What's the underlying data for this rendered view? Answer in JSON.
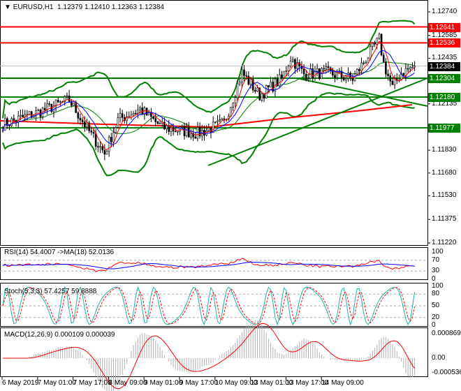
{
  "header": {
    "symbol": "EURUSD,H1",
    "ohlc": "1.12379 1.12410 1.12363 1.12384"
  },
  "colors": {
    "bull": "#ffffff",
    "bear": "#000000",
    "band": "#008000",
    "ma_fast": "#ff0000",
    "ma_slow": "#0000ff",
    "level_red": "#ff0000",
    "level_green": "#008000",
    "current": "#000000"
  },
  "chart_data": {
    "type": "line",
    "title": "EURUSD,H1",
    "ylim": [
      1.1122,
      1.1274
    ],
    "price_ticks": [
      "1.12740",
      "1.12585",
      "1.12435",
      "1.12285",
      "1.12135",
      "1.11830",
      "1.11680",
      "1.11530",
      "1.11375",
      "1.11220"
    ],
    "price_path_hours": [
      0,
      8,
      16,
      30,
      40,
      46,
      52,
      62,
      72,
      88,
      100,
      108,
      116,
      126,
      130,
      136,
      146,
      158,
      170,
      172,
      176,
      180,
      186
    ],
    "price_path_values": [
      1.12,
      1.1204,
      1.1208,
      1.1216,
      1.1193,
      1.1181,
      1.1203,
      1.121,
      1.1198,
      1.1194,
      1.1201,
      1.1234,
      1.1219,
      1.123,
      1.1244,
      1.1233,
      1.1234,
      1.123,
      1.1256,
      1.124,
      1.1224,
      1.1234,
      1.12384
    ],
    "levels": [
      {
        "label": "1.12641",
        "value": 1.12641,
        "color": "red"
      },
      {
        "label": "1.12536",
        "value": 1.12536,
        "color": "red"
      },
      {
        "label": "1.12384",
        "value": 1.12384,
        "color": "current"
      },
      {
        "label": "1.12304",
        "value": 1.12304,
        "color": "green"
      },
      {
        "label": "1.12180",
        "value": 1.1218,
        "color": "green"
      },
      {
        "label": "1.11977",
        "value": 1.11977,
        "color": "green"
      }
    ],
    "time_labels": [
      "6 May 2019",
      "7 May 01:00",
      "7 May 17:00",
      "8 May 09:00",
      "9 May 01:00",
      "9 May 17:00",
      "10 May 09:00",
      "13 May 01:00",
      "13 May 17:00",
      "14 May 09:00"
    ],
    "rsi": {
      "label": "RSI(14) 54.4007  ->MA(18) 52.0136",
      "ticks": [
        "100",
        "70",
        "30",
        "0"
      ]
    },
    "stoch": {
      "label": "Stoch(5,3,3) 57.4257 59.8888",
      "ticks": [
        "100",
        "80",
        "50",
        "20",
        "0"
      ]
    },
    "macd": {
      "label": "MACD(12,26,9) 0.000109 0.000039",
      "ticks": [
        "0.000869",
        "0.00",
        "-0.000536"
      ]
    }
  }
}
